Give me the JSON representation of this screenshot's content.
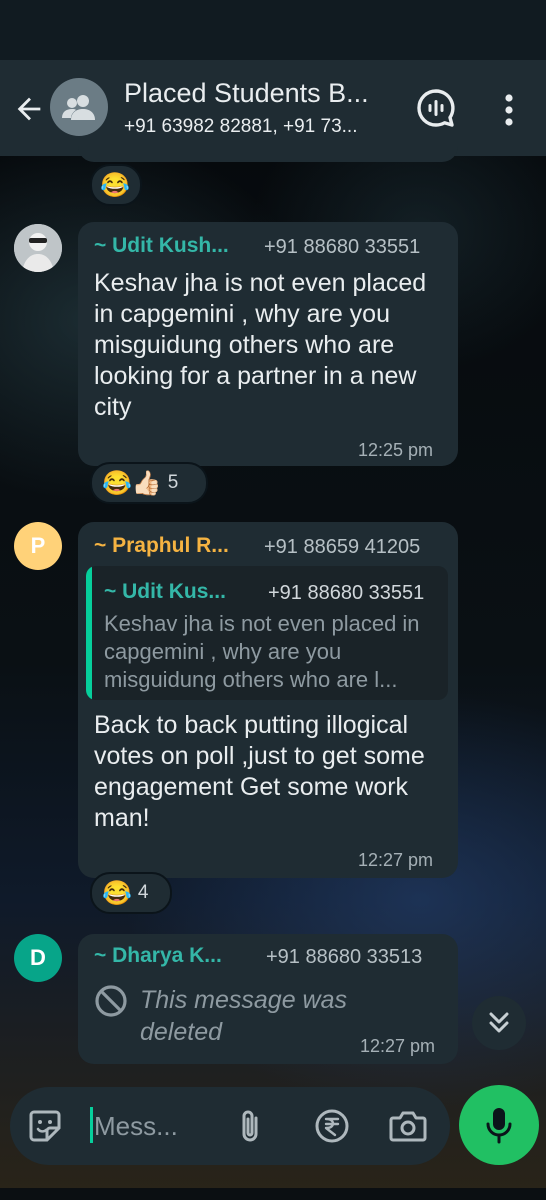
{
  "header": {
    "title": "Placed Students B...",
    "subtitle": "+91 63982 82881, +91 73..."
  },
  "previous_message": {
    "reaction": "😂"
  },
  "messages": [
    {
      "sender": "~ Udit Kush...",
      "phone": "+91 88680 33551",
      "text": "Keshav jha is not even placed in capgemini , why are you misguidung others who are looking for a partner in a new city",
      "time": "12:25 pm",
      "reactions": "😂👍🏻",
      "reaction_count": "5",
      "sender_color": "#34b7a8"
    },
    {
      "sender": "~ Praphul R...",
      "phone": "+91 88659 41205",
      "avatar_initial": "P",
      "avatar_color": "#ffd279",
      "quote": {
        "sender": "~ Udit Kus...",
        "phone": "+91 88680 33551",
        "text": "Keshav jha is not even placed in capgemini , why are you misguidung others who are l..."
      },
      "text": "Back to back putting illogical votes on poll ,just to get some engagement Get some work man!",
      "time": "12:27 pm",
      "reactions": "😂",
      "reaction_count": "4",
      "sender_color": "#f5b342"
    },
    {
      "sender": "~ Dharya K...",
      "phone": "+91 88680 33513",
      "avatar_initial": "D",
      "avatar_color": "#07a589",
      "text": "This message was deleted",
      "time": "12:27 pm",
      "sender_color": "#34b7a8"
    }
  ],
  "input": {
    "placeholder": "Mess..."
  },
  "colors": {
    "accent": "#21c063",
    "bubble": "#1f2c33",
    "header": "#1f2c33"
  }
}
